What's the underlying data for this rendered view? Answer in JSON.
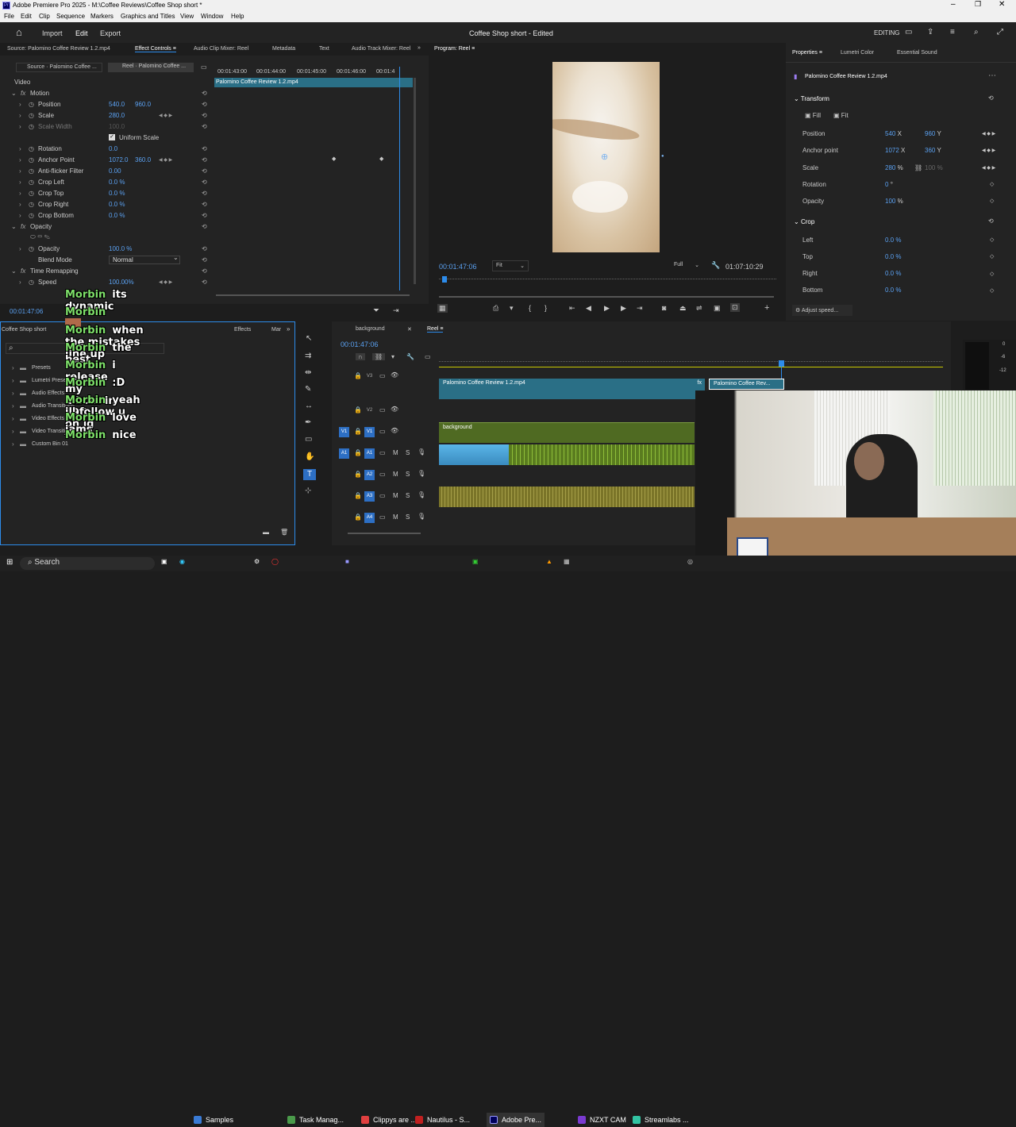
{
  "titlebar": {
    "title": "Adobe Premiere Pro 2025 - M:\\Coffee Reviews\\Coffee Shop short *"
  },
  "menu": [
    "File",
    "Edit",
    "Clip",
    "Sequence",
    "Markers",
    "Graphics and Titles",
    "View",
    "Window",
    "Help"
  ],
  "workspace": {
    "tabs": [
      "Import",
      "Edit",
      "Export"
    ],
    "active": "Edit",
    "project": "Coffee Shop short",
    "status": "Edited",
    "mode": "EDITING"
  },
  "top_tabs": {
    "source": "Source: Palomino Coffee Review 1.2.mp4",
    "effect_controls": "Effect Controls",
    "audio_clip_mixer": "Audio Clip Mixer: Reel",
    "metadata": "Metadata",
    "text": "Text",
    "audio_track_mixer": "Audio Track Mixer: Reel"
  },
  "effect_controls": {
    "source_tab": "Source · Palomino Coffee ...",
    "reel_tab": "Reel · Palomino Coffee ...",
    "timecodes": [
      "00:01:43:00",
      "00:01:44:00",
      "00:01:45:00",
      "00:01:46:00",
      "00:01:4"
    ],
    "clip_name": "Palomino Coffee Review 1.2.mp4",
    "section_video": "Video",
    "props": [
      {
        "label": "Motion",
        "v1": "",
        "v2": ""
      },
      {
        "label": "Position",
        "v1": "540.0",
        "v2": "960.0"
      },
      {
        "label": "Scale",
        "v1": "280.0",
        "v2": ""
      },
      {
        "label": "Scale Width",
        "v1": "100.0",
        "v2": ""
      },
      {
        "label": "Uniform Scale",
        "v1": "",
        "v2": ""
      },
      {
        "label": "Rotation",
        "v1": "0.0",
        "v2": ""
      },
      {
        "label": "Anchor Point",
        "v1": "1072.0",
        "v2": "360.0"
      },
      {
        "label": "Anti-flicker Filter",
        "v1": "0.00",
        "v2": ""
      },
      {
        "label": "Crop Left",
        "v1": "0.0 %",
        "v2": ""
      },
      {
        "label": "Crop Top",
        "v1": "0.0 %",
        "v2": ""
      },
      {
        "label": "Crop Right",
        "v1": "0.0 %",
        "v2": ""
      },
      {
        "label": "Crop Bottom",
        "v1": "0.0 %",
        "v2": ""
      },
      {
        "label": "Opacity",
        "v1": "",
        "v2": ""
      },
      {
        "label": "",
        "v1": "",
        "v2": ""
      },
      {
        "label": "Opacity",
        "v1": "100.0 %",
        "v2": ""
      },
      {
        "label": "Blend Mode",
        "v1": "Normal",
        "v2": ""
      },
      {
        "label": "Time Remapping",
        "v1": "",
        "v2": ""
      },
      {
        "label": "Speed",
        "v1": "100.00%",
        "v2": ""
      }
    ],
    "timecode": "00:01:47:06"
  },
  "program": {
    "title": "Program: Reel",
    "timecode": "00:01:47:06",
    "fit": "Fit",
    "quality": "Full",
    "duration": "01:07:10:29"
  },
  "properties": {
    "tabs": [
      "Properties",
      "Lumetri Color",
      "Essential Sound"
    ],
    "clip": "Palomino Coffee Review 1.2.mp4",
    "transform": "Transform",
    "fill": "Fill",
    "fit": "Fit",
    "rows": [
      {
        "label": "Position",
        "a": "540",
        "au": "X",
        "b": "960",
        "bu": "Y"
      },
      {
        "label": "Anchor point",
        "a": "1072",
        "au": "X",
        "b": "360",
        "bu": "Y"
      },
      {
        "label": "Scale",
        "a": "280",
        "au": "%",
        "b": "100",
        "bu": "%"
      },
      {
        "label": "Rotation",
        "a": "0",
        "au": "°",
        "b": "",
        "bu": ""
      },
      {
        "label": "Opacity",
        "a": "100",
        "au": "%",
        "b": "",
        "bu": ""
      }
    ],
    "crop": "Crop",
    "crop_rows": [
      {
        "label": "Left",
        "v": "0.0 %"
      },
      {
        "label": "Top",
        "v": "0.0 %"
      },
      {
        "label": "Right",
        "v": "0.0 %"
      },
      {
        "label": "Bottom",
        "v": "0.0 %"
      }
    ],
    "adjust": "Adjust speed..."
  },
  "project_panel": {
    "tab": "Coffee Shop short",
    "effects_tab": "Effects",
    "markers_tab": "Mar",
    "bins": [
      "Presets",
      "Lumetri Presets",
      "Audio Effects",
      "Audio Transitions",
      "Video Effects",
      "Video Transitions",
      "Custom Bin 01"
    ]
  },
  "timeline": {
    "tabs": [
      "background",
      "Reel"
    ],
    "timecode": "00:01:47:06",
    "tracks": [
      {
        "name": "V3"
      },
      {
        "name": "V2"
      },
      {
        "name": "V1",
        "src": "V1"
      },
      {
        "name": "A1",
        "src": "A1"
      },
      {
        "name": "A2"
      },
      {
        "name": "A3"
      },
      {
        "name": "A4"
      }
    ],
    "clip1": "Palomino Coffee Review 1.2.mp4",
    "clip2": "Palomino Coffee Rev...",
    "clip_bg": "background"
  },
  "meter": [
    "0",
    "-6",
    "-12"
  ],
  "chat": [
    {
      "user": "Morbin",
      "msg": "its dynamic"
    },
    {
      "user": "Morbin",
      "msg": ""
    },
    {
      "user": "Morbin",
      "msg": "when the mistakes line up"
    },
    {
      "user": "Morbin",
      "msg": "the best"
    },
    {
      "user": "Morbin",
      "msg": "i release my album in 19days"
    },
    {
      "user": "Morbin",
      "msg": ":D"
    },
    {
      "user": "Morbin",
      "msg": "yeah ill follow u on ig"
    },
    {
      "user": "Morbin",
      "msg": "love jams"
    },
    {
      "user": "Morbin",
      "msg": "nice"
    }
  ],
  "taskbar": {
    "search": "Search",
    "items": [
      "Samples",
      "Task Manag...",
      "Clippys are ...",
      "Nautilus - S...",
      "Adobe Pre...",
      "NZXT CAM",
      "Streamlabs ..."
    ]
  },
  "colors": {
    "accent": "#2d8ceb",
    "clip_blue": "#2a6f86",
    "clip_green": "#4f6a22",
    "audio_green": "#5a7c1f",
    "audio_yellow": "#7a7428"
  }
}
